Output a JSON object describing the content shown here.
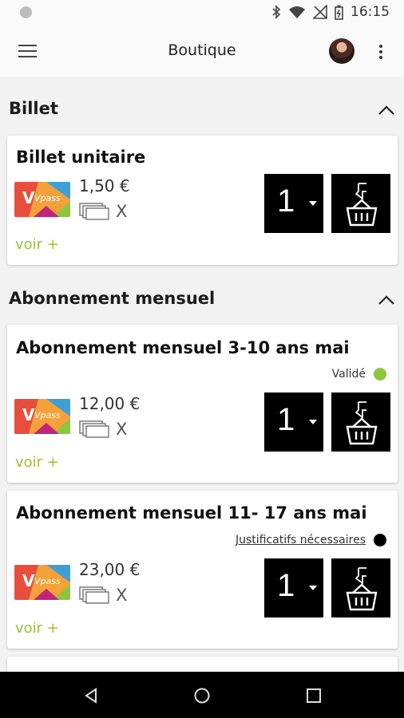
{
  "status_bar": {
    "time": "16:15"
  },
  "app_bar": {
    "title": "Boutique"
  },
  "sections": [
    {
      "title": "Billet",
      "products": [
        {
          "name": "Billet unitaire",
          "price": "1,50 €",
          "tickets": "X",
          "more": "voir +",
          "quantity": "1",
          "status": ""
        }
      ]
    },
    {
      "title": "Abonnement mensuel",
      "products": [
        {
          "name": "Abonnement mensuel 3-10 ans mai",
          "price": "12,00 €",
          "tickets": "X",
          "more": "voir +",
          "quantity": "1",
          "status": "Validé",
          "status_color": "#8dc63f"
        },
        {
          "name": "Abonnement mensuel 11- 17 ans mai",
          "price": "23,00 €",
          "tickets": "X",
          "more": "voir +",
          "quantity": "1",
          "status": "Justificatifs nécessaires",
          "status_color": "#000000"
        }
      ]
    }
  ],
  "colors": {
    "accent": "#9ac037",
    "valid": "#8dc63f",
    "button": "#000000"
  },
  "pass_brand": "Vpass"
}
